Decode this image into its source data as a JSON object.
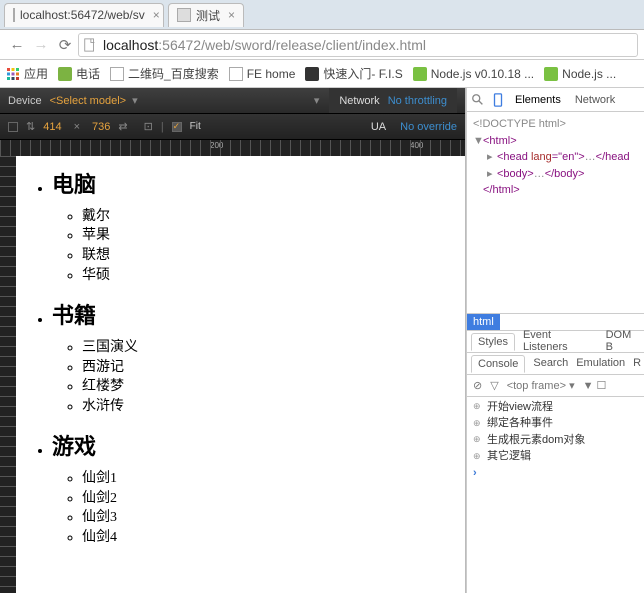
{
  "tabs": [
    {
      "title": "localhost:56472/web/sv"
    },
    {
      "title": "测试"
    }
  ],
  "url": {
    "host": "localhost",
    "rest": ":56472/web/sword/release/client/index.html"
  },
  "bookmarks": {
    "apps": "应用",
    "items": [
      "电话",
      "二维码_百度搜索",
      "FE home",
      "快速入门- F.I.S",
      "Node.js v0.10.18 ...",
      "Node.js ..."
    ]
  },
  "device": {
    "label": "Device",
    "select": "<Select model>",
    "width": "414",
    "height": "736",
    "fit": "Fit",
    "networkLabel": "Network",
    "networkValue": "No throttling",
    "uaLabel": "UA",
    "uaValue": "No override"
  },
  "ruler": {
    "t200": "200",
    "t400": "400"
  },
  "content": {
    "categories": [
      {
        "name": "电脑",
        "items": [
          "戴尔",
          "苹果",
          "联想",
          "华硕"
        ]
      },
      {
        "name": "书籍",
        "items": [
          "三国演义",
          "西游记",
          "红楼梦",
          "水浒传"
        ]
      },
      {
        "name": "游戏",
        "items": [
          "仙剑1",
          "仙剑2",
          "仙剑3",
          "仙剑4"
        ]
      }
    ]
  },
  "devtools": {
    "tabs": {
      "elements": "Elements",
      "network": "Network"
    },
    "dom": {
      "doctype": "<!DOCTYPE html>",
      "htmlOpen": "<html>",
      "headOpen": "<head ",
      "headLang": "lang",
      "headLangV": "=\"en\">",
      "headDots": "…",
      "headClose": "</head",
      "bodyOpen": "<body>",
      "bodyDots": "…",
      "bodyClose": "</body>",
      "htmlClose": "</html>"
    },
    "breadcrumb": "html",
    "subTabs": {
      "styles": "Styles",
      "eventListeners": "Event Listeners",
      "dom": "DOM B"
    },
    "consoleTabs": {
      "console": "Console",
      "search": "Search",
      "emulation": "Emulation",
      "r": "R"
    },
    "frameSelect": "<top frame>",
    "logs": [
      "开始view流程",
      "绑定各种事件",
      "生成根元素dom对象",
      "其它逻辑"
    ]
  }
}
